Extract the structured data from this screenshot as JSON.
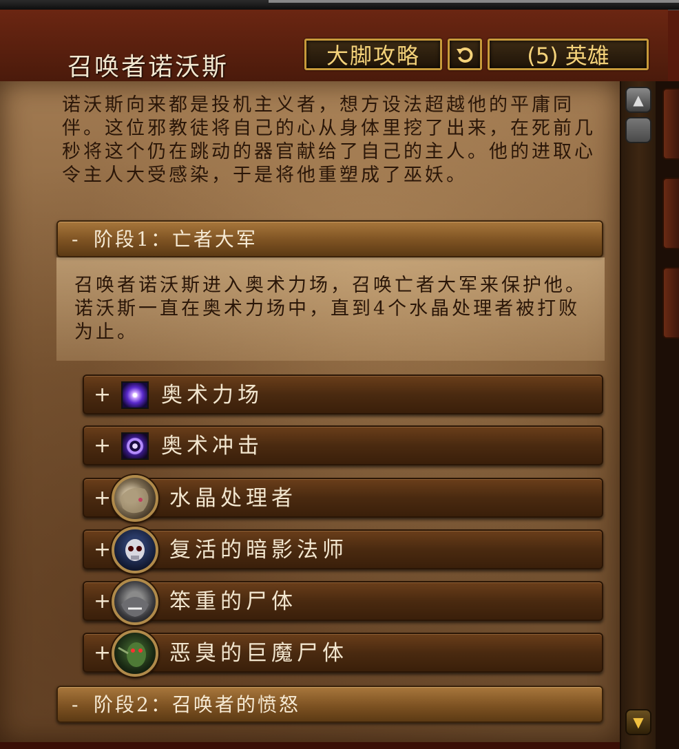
{
  "window": {
    "title": "召唤者诺沃斯",
    "guide_button": "大脚攻略",
    "reset_icon": "refresh-icon",
    "difficulty_button": "(5) 英雄"
  },
  "lore": "诺沃斯向来都是投机主义者，想方设法超越他的平庸同伴。这位邪教徒将自己的心从身体里挖了出来，在死前几秒将这个仍在跳动的器官献给了自己的主人。他的进取心令主人大受感染，于是将他重塑成了巫妖。",
  "phases": [
    {
      "symbol": "-",
      "label": "阶段1：亡者大军",
      "description": "召唤者诺沃斯进入奥术力场，召唤亡者大军来保护他。诺沃斯一直在奥术力场中，直到4个水晶处理者被打败为止。",
      "abilities": [
        {
          "symbol": "+",
          "label": "奥术力场",
          "icon": "arcane-field-spell-icon"
        },
        {
          "symbol": "+",
          "label": "奥术冲击",
          "icon": "arcane-blast-spell-icon"
        },
        {
          "symbol": "+",
          "label": "水晶处理者",
          "icon": "crystal-handler-portrait-icon"
        },
        {
          "symbol": "+",
          "label": "复活的暗影法师",
          "icon": "risen-shadowcaster-portrait-icon"
        },
        {
          "symbol": "+",
          "label": "笨重的尸体",
          "icon": "hulking-corpse-portrait-icon"
        },
        {
          "symbol": "+",
          "label": "恶臭的巨魔尸体",
          "icon": "fetid-troll-corpse-portrait-icon"
        }
      ]
    },
    {
      "symbol": "-",
      "label": "阶段2：召唤者的愤怒"
    }
  ],
  "scrollbar": {
    "up_icon": "scroll-up-icon",
    "down_icon": "scroll-down-icon"
  },
  "colors": {
    "parchment": "#8a6440",
    "button_border": "#c89a3a",
    "button_text": "#f4d27a",
    "header_bar": "#7d5222"
  }
}
